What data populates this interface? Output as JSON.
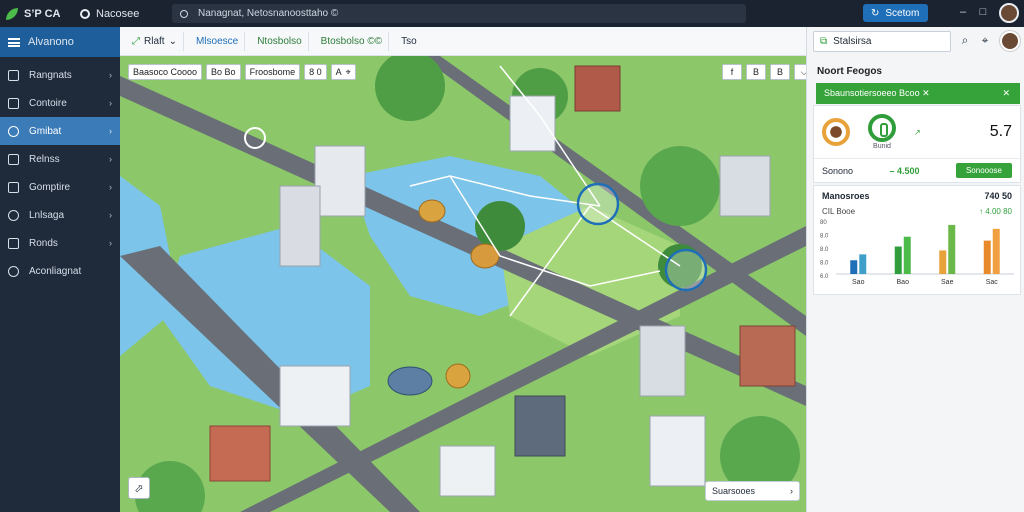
{
  "topbar": {
    "logo_text": "S’P CA",
    "app_name": "Nacosee",
    "address_text": "Nanagnat, Netosnanoosttaho ©                                                        ",
    "primary_button": "Scetom",
    "minimize": "–",
    "maximize": "□",
    "close": "✕"
  },
  "sidebar": {
    "header": "Alvanono",
    "items": [
      {
        "label": "Rangnats",
        "icon": "chart-icon"
      },
      {
        "label": "Contoire",
        "icon": "folder-icon"
      },
      {
        "label": "Gmibat",
        "icon": "link-icon",
        "active": true
      },
      {
        "label": "Relnss",
        "icon": "table-icon"
      },
      {
        "label": "Gomptire",
        "icon": "gear-icon"
      },
      {
        "label": "Lnlsaga",
        "icon": "globe-icon"
      },
      {
        "label": "Ronds",
        "icon": "edit-icon"
      },
      {
        "label": "Aconliagnat",
        "icon": "settings-icon"
      }
    ]
  },
  "map_toolbar": {
    "chips": [
      "Rlaft",
      "Mlsoesce",
      "Ntosbolso",
      "Btosbolso ©©",
      "Tso"
    ]
  },
  "map_overlay": {
    "chips": [
      "Baasoco Coooo",
      "Bo Bo",
      "Froosbome",
      "8 0",
      "A"
    ],
    "controls": [
      "f",
      "B",
      "B",
      "⌵"
    ],
    "status_button": "Suarsooes"
  },
  "right_panel": {
    "search_text": "Stalsirsa",
    "panel_title": "Noort Feogos",
    "alert_text": "Sbaunsotiersoeeo Bcoo ✕",
    "alert_close": "✕",
    "kpi_caption": "Bunid",
    "kpi_value": "5.7",
    "kpi_trend": "↗",
    "footer_label": "Sonono",
    "footer_value": "– 4.500",
    "footer_button": "Sonooose",
    "chart_card": {
      "title": "Manosroes",
      "title_value": "740 50",
      "sub_left": "CIL  Booe",
      "sub_right": "↑ 4.00 80"
    },
    "colors": {
      "accent": "#36a33a",
      "blue": "#1f6fb8"
    }
  },
  "chart_data": {
    "type": "bar",
    "categories": [
      "Sao",
      "Bao",
      "Sae",
      "Sac"
    ],
    "series": [
      {
        "values": [
          14,
          28,
          24,
          34
        ]
      },
      {
        "values": [
          20,
          38,
          50,
          46
        ]
      }
    ],
    "ytick_labels": [
      "80",
      "8.0",
      "8.0",
      "8.0",
      "6.0"
    ],
    "ylim": [
      0,
      55
    ]
  }
}
